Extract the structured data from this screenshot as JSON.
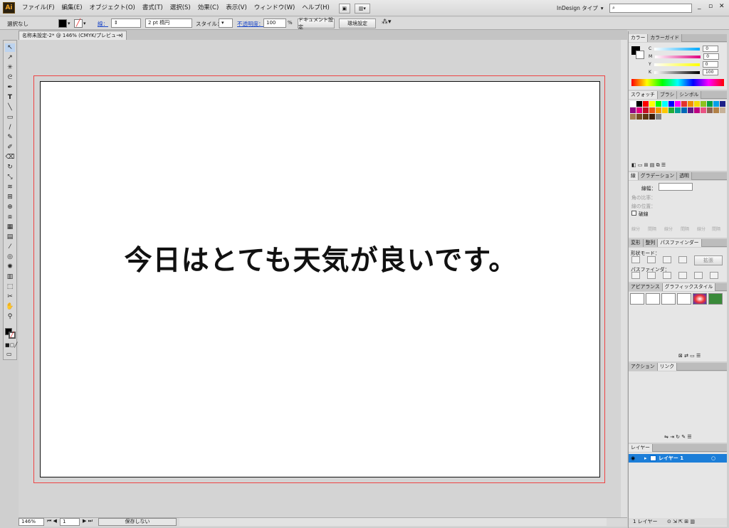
{
  "app": {
    "logo": "Ai"
  },
  "menubar": {
    "items": [
      "ファイル(F)",
      "編集(E)",
      "オブジェクト(O)",
      "書式(T)",
      "選択(S)",
      "効果(C)",
      "表示(V)",
      "ウィンドウ(W)",
      "ヘルプ(H)"
    ],
    "workspace": "InDesign タイプ",
    "search_placeholder": "",
    "window_buttons": [
      "_",
      "▫",
      "✕"
    ]
  },
  "control": {
    "selection": "選択なし",
    "stroke_label": "線：",
    "stroke_weight": "2 pt 楕円",
    "style_label": "スタイル：",
    "opacity_label": "不透明度：",
    "opacity_value": "100",
    "opacity_unit": "%",
    "doc_setup": "ドキュメント設定",
    "prefs": "環境設定"
  },
  "document": {
    "tab_title": "名称未設定-2* @ 146% (CMYK/プレビュー)",
    "tab_close": "×",
    "text": "今日はとても天気が良いです。"
  },
  "status": {
    "zoom": "146%",
    "page": "1",
    "save_state": "保存しない"
  },
  "panels": {
    "color": {
      "tabs": [
        "カラー",
        "カラーガイド"
      ],
      "channels": [
        {
          "name": "C",
          "value": "0"
        },
        {
          "name": "M",
          "value": "0"
        },
        {
          "name": "Y",
          "value": "0"
        },
        {
          "name": "K",
          "value": "100"
        }
      ]
    },
    "swatches": {
      "tabs": [
        "スウォッチ",
        "ブラシ",
        "シンボル"
      ]
    },
    "stroke": {
      "tabs": [
        "線",
        "グラデーション",
        "透明"
      ],
      "weight_label": "線幅：",
      "miter_label": "角の比率：",
      "align_label": "線の位置：",
      "dashed_label": "破線",
      "dash_labels": [
        "線分",
        "間隔",
        "線分",
        "間隔",
        "線分",
        "間隔"
      ]
    },
    "pathfinder": {
      "tabs": [
        "変形",
        "整列",
        "パスファインダー"
      ],
      "shape_modes": "形状モード：",
      "expand": "拡張",
      "pathfinders": "パスファインダ："
    },
    "appearance": {
      "tabs": [
        "アピアランス",
        "グラフィックスタイル"
      ]
    },
    "actions": {
      "tabs": [
        "アクション",
        "リンク"
      ]
    },
    "layers": {
      "tabs": [
        "レイヤー"
      ],
      "layer_name": "レイヤー 1",
      "count": "1 レイヤー"
    }
  },
  "colors": {
    "accent": "#1c7ed8",
    "bleed": "#e44444",
    "swatches": [
      "#ffffff",
      "#000000",
      "#ff0000",
      "#ffff00",
      "#00ff00",
      "#00ffff",
      "#0000ff",
      "#ff00ff",
      "#e5322d",
      "#f08c00",
      "#f5d800",
      "#8dc21f",
      "#00a040",
      "#00a0e9",
      "#1d2088",
      "#920783",
      "#e4007f",
      "#c30d23",
      "#ea5514",
      "#f39800",
      "#fcc800",
      "#22ac38",
      "#009e96",
      "#0068b7",
      "#601986",
      "#be0081",
      "#e95383",
      "#8f6552",
      "#b28146",
      "#c7b299",
      "#a67c52",
      "#754c24",
      "#603813",
      "#3c1e0b",
      "#808080"
    ]
  }
}
